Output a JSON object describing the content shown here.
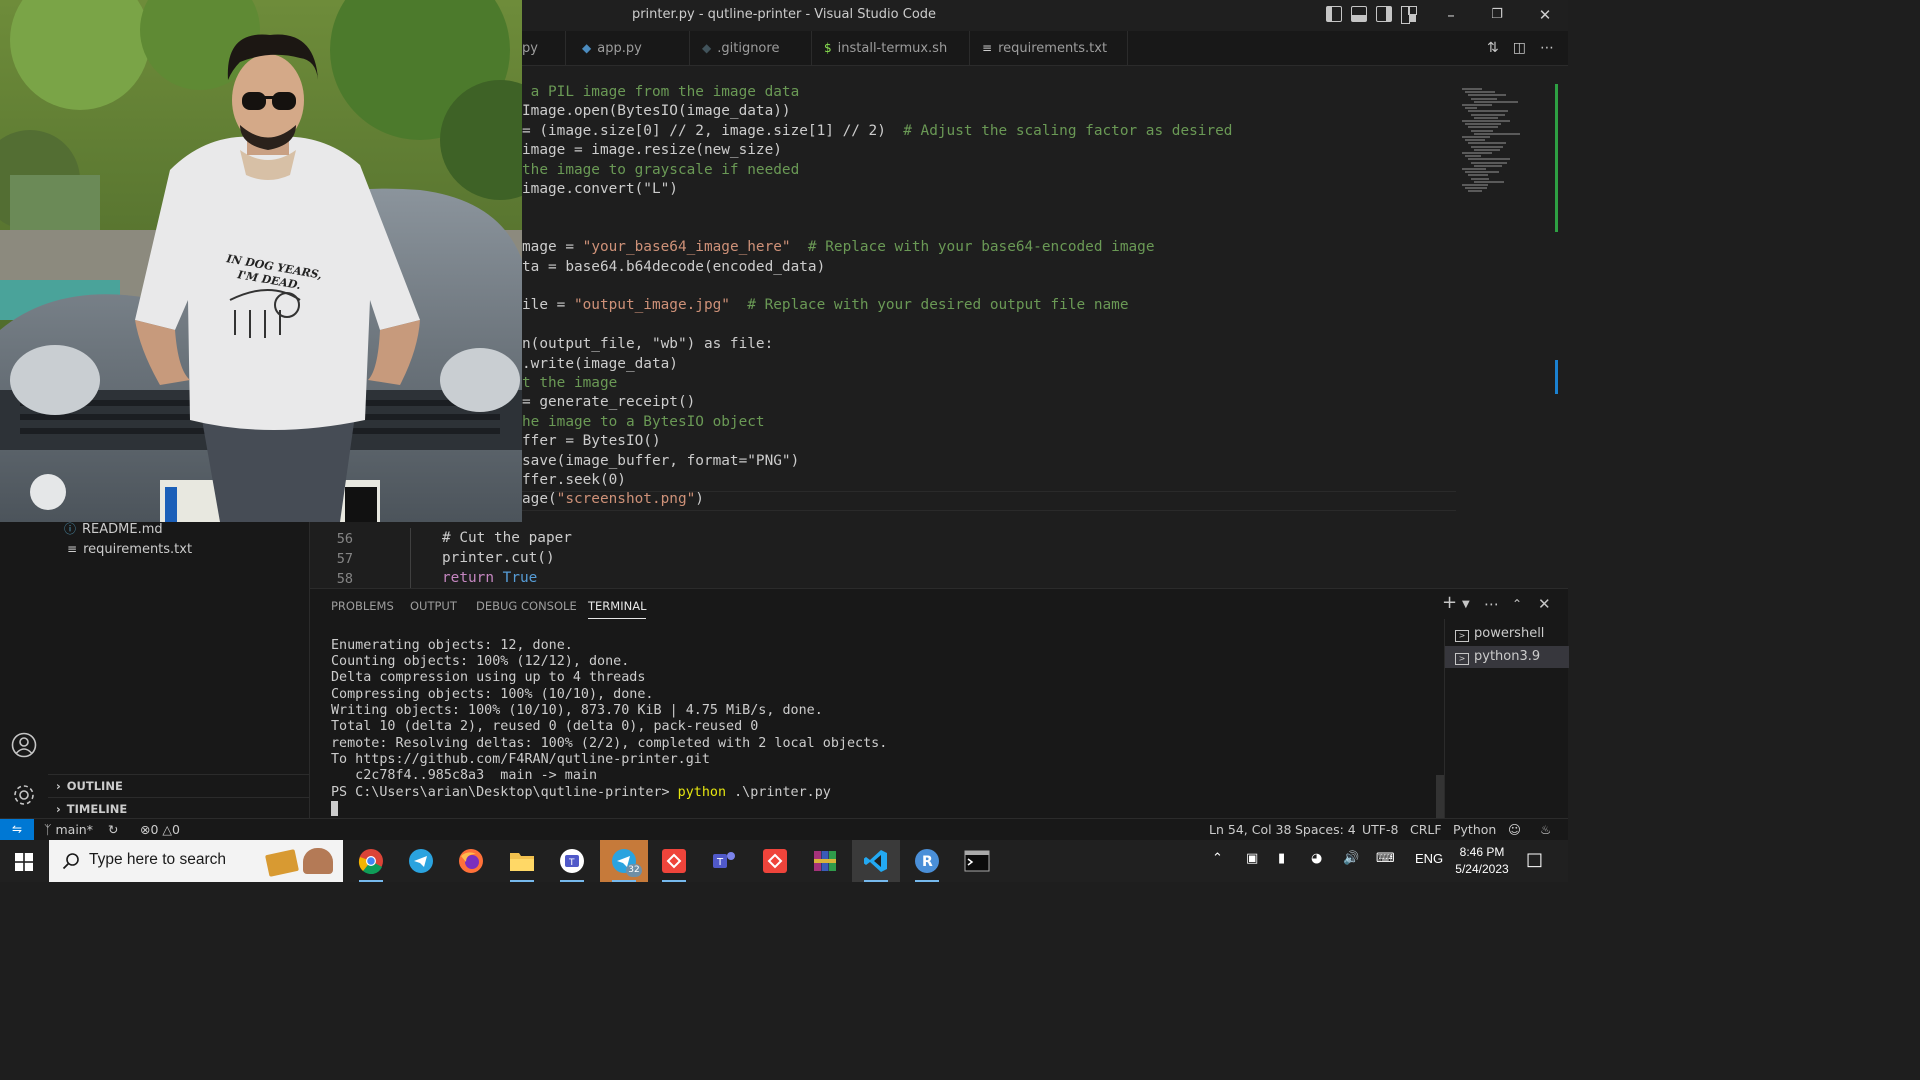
{
  "window": {
    "title": "printer.py - qutline-printer - Visual Studio Code"
  },
  "tabs": [
    {
      "label": "py",
      "icon": "python-file-icon"
    },
    {
      "label": "app.py",
      "icon": "python-file-icon"
    },
    {
      "label": ".gitignore",
      "icon": "git-file-icon"
    },
    {
      "label": "install-termux.sh",
      "icon": "shell-file-icon"
    },
    {
      "label": "requirements.txt",
      "icon": "text-file-icon"
    }
  ],
  "editor": {
    "lines": [
      {
        "code": " a PIL image from the image data",
        "type": "comment"
      },
      {
        "code": "Image.open(BytesIO(image_data))"
      },
      {
        "code": "= (image.size[0] // 2, image.size[1] // 2)",
        "comment": "  # Adjust the scaling factor as desired"
      },
      {
        "code": "image = image.resize(new_size)"
      },
      {
        "code": "the image to grayscale if needed",
        "type": "comment"
      },
      {
        "code": "image.convert(\"L\")"
      },
      {
        "code": ""
      },
      {
        "code": ""
      },
      {
        "code": "mage = ",
        "string": "\"your_base64_image_here\"",
        "comment": "  # Replace with your base64-encoded image"
      },
      {
        "code": "ta = base64.b64decode(encoded_data)"
      },
      {
        "code": ""
      },
      {
        "code": "ile = ",
        "string": "\"output_image.jpg\"",
        "comment": "  # Replace with your desired output file name"
      },
      {
        "code": ""
      },
      {
        "code": "n(output_file, \"wb\") as file:"
      },
      {
        "code": ".write(image_data)"
      },
      {
        "code": "t the image",
        "type": "comment"
      },
      {
        "code": "= generate_receipt()"
      },
      {
        "code": "he image to a BytesIO object",
        "type": "comment"
      },
      {
        "code": "ffer = BytesIO()"
      },
      {
        "code": "save(image_buffer, format=\"PNG\")"
      },
      {
        "code": "ffer.seek(0)"
      },
      {
        "code": "age(",
        "string": "\"screenshot.png\"",
        "tail": ")"
      }
    ],
    "numbered": [
      {
        "num": "56",
        "code": "# Cut the paper"
      },
      {
        "num": "57",
        "code": "printer.cut()"
      },
      {
        "num": "58",
        "keyword": "return",
        "value": "True"
      }
    ]
  },
  "sidebar": {
    "files": [
      "README.md",
      "requirements.txt"
    ],
    "sections": [
      "OUTLINE",
      "TIMELINE"
    ]
  },
  "panel": {
    "tabs": [
      "PROBLEMS",
      "OUTPUT",
      "DEBUG CONSOLE",
      "TERMINAL"
    ],
    "active_tab": "TERMINAL",
    "terminal_lines": [
      "Enumerating objects: 12, done.",
      "Counting objects: 100% (12/12), done.",
      "Delta compression using up to 4 threads",
      "Compressing objects: 100% (10/10), done.",
      "Writing objects: 100% (10/10), 873.70 KiB | 4.75 MiB/s, done.",
      "Total 10 (delta 2), reused 0 (delta 0), pack-reused 0",
      "remote: Resolving deltas: 100% (2/2), completed with 2 local objects.",
      "To https://github.com/F4RAN/qutline-printer.git",
      "   c2c78f4..985c8a3  main -> main"
    ],
    "prompt": "PS C:\\Users\\arian\\Desktop\\qutline-printer> ",
    "command": "python",
    "command_args": " .\\printer.py",
    "terminals": [
      "powershell",
      "python3.9"
    ]
  },
  "statusbar": {
    "branch": "main*",
    "errors": "0",
    "warnings": "0",
    "position": "Ln 54, Col 38",
    "spaces": "Spaces: 4",
    "encoding": "UTF-8",
    "eol": "CRLF",
    "language": "Python"
  },
  "taskbar": {
    "search_placeholder": "Type here to search",
    "telegram_badge": "32",
    "language": "ENG",
    "time": "8:46 PM",
    "date": "5/24/2023"
  },
  "photo": {
    "shirt_text_line1": "IN DOG YEARS,",
    "shirt_text_line2": "I'M DEAD."
  },
  "colors": {
    "accent": "#0078d4",
    "editor_bg": "#1e1e1e",
    "string": "#ce9178",
    "comment": "#6a9955",
    "keyword": "#c586c0"
  }
}
